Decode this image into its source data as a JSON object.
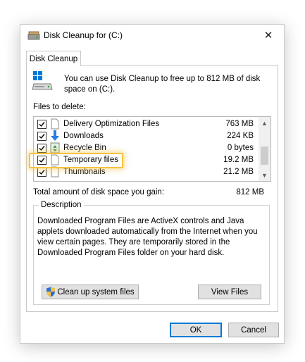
{
  "window": {
    "title": "Disk Cleanup for  (C:)",
    "close_glyph": "✕"
  },
  "tab": {
    "label": "Disk Cleanup"
  },
  "intro": {
    "text": "You can use Disk Cleanup to free up to 812 MB of disk space on  (C:)."
  },
  "files": {
    "label": "Files to delete:",
    "items": [
      {
        "name": "Delivery Optimization Files",
        "size": "763 MB",
        "checked": true,
        "icon": "blank-file-icon"
      },
      {
        "name": "Downloads",
        "size": "224 KB",
        "checked": true,
        "icon": "download-arrow-icon"
      },
      {
        "name": "Recycle Bin",
        "size": "0 bytes",
        "checked": true,
        "icon": "recycle-bin-icon"
      },
      {
        "name": "Temporary files",
        "size": "19.2 MB",
        "checked": true,
        "icon": "blank-file-icon"
      },
      {
        "name": "Thumbnails",
        "size": "21.2 MB",
        "checked": true,
        "icon": "blank-file-icon"
      }
    ]
  },
  "total": {
    "label": "Total amount of disk space you gain:",
    "value": "812 MB"
  },
  "description": {
    "legend": "Description",
    "text": "Downloaded Program Files are ActiveX controls and Java applets downloaded automatically from the Internet when you view certain pages. They are temporarily stored in the Downloaded Program Files folder on your hard disk."
  },
  "buttons": {
    "cleanup_system": "Clean up system files",
    "view_files": "View Files",
    "ok": "OK",
    "cancel": "Cancel"
  },
  "colors": {
    "highlight": "#f5c342",
    "ok_border": "#0078d7",
    "button_face": "#e1e1e1"
  }
}
